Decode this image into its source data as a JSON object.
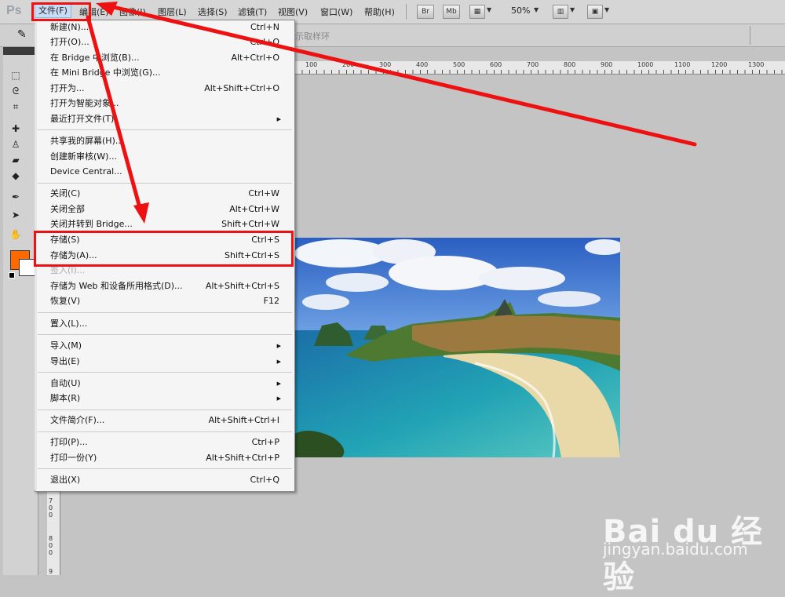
{
  "app": {
    "logo": "Ps"
  },
  "menubar": {
    "items": [
      "文件(F)",
      "编辑(E)",
      "图像(I)",
      "图层(L)",
      "选择(S)",
      "滤镜(T)",
      "视图(V)",
      "窗口(W)",
      "帮助(H)"
    ],
    "br": "Br",
    "mb": "Mb",
    "zoom": "50%"
  },
  "optbar": {
    "hint": "示取样环"
  },
  "ruler": {
    "top": [
      "100",
      "200",
      "300",
      "400",
      "500",
      "600",
      "700",
      "800",
      "900",
      "1000",
      "1100",
      "1200",
      "1300"
    ],
    "left": [
      "7",
      "0",
      "0",
      "8",
      "0",
      "0",
      "9"
    ]
  },
  "file_menu": {
    "new": {
      "label": "新建(N)...",
      "shortcut": "Ctrl+N"
    },
    "open": {
      "label": "打开(O)...",
      "shortcut": "Ctrl+O"
    },
    "browse_bridge": {
      "label": "在 Bridge 中浏览(B)...",
      "shortcut": "Alt+Ctrl+O"
    },
    "browse_mini_bridge": {
      "label": "在 Mini Bridge 中浏览(G)..."
    },
    "open_as": {
      "label": "打开为...",
      "shortcut": "Alt+Shift+Ctrl+O"
    },
    "open_smart": {
      "label": "打开为智能对象..."
    },
    "recent": {
      "label": "最近打开文件(T)"
    },
    "share_screen": {
      "label": "共享我的屏幕(H)..."
    },
    "new_review": {
      "label": "创建新审核(W)..."
    },
    "device_central": {
      "label": "Device Central..."
    },
    "close": {
      "label": "关闭(C)",
      "shortcut": "Ctrl+W"
    },
    "close_all": {
      "label": "关闭全部",
      "shortcut": "Alt+Ctrl+W"
    },
    "close_bridge": {
      "label": "关闭并转到 Bridge...",
      "shortcut": "Shift+Ctrl+W"
    },
    "save": {
      "label": "存储(S)",
      "shortcut": "Ctrl+S"
    },
    "save_as": {
      "label": "存储为(A)...",
      "shortcut": "Shift+Ctrl+S"
    },
    "check_in": {
      "label": "签入(I)..."
    },
    "save_web": {
      "label": "存储为 Web 和设备所用格式(D)...",
      "shortcut": "Alt+Shift+Ctrl+S"
    },
    "revert": {
      "label": "恢复(V)",
      "shortcut": "F12"
    },
    "place": {
      "label": "置入(L)..."
    },
    "import": {
      "label": "导入(M)"
    },
    "export": {
      "label": "导出(E)"
    },
    "automate": {
      "label": "自动(U)"
    },
    "scripts": {
      "label": "脚本(R)"
    },
    "file_info": {
      "label": "文件简介(F)...",
      "shortcut": "Alt+Shift+Ctrl+I"
    },
    "print": {
      "label": "打印(P)...",
      "shortcut": "Ctrl+P"
    },
    "print_one": {
      "label": "打印一份(Y)",
      "shortcut": "Alt+Shift+Ctrl+P"
    },
    "exit": {
      "label": "退出(X)",
      "shortcut": "Ctrl+Q"
    }
  },
  "watermark": {
    "logo": "Bai du 经验",
    "url": "jingyan.baidu.com"
  },
  "colors": {
    "accent_red": "#ee1111",
    "foreground": "#ff6a00"
  }
}
